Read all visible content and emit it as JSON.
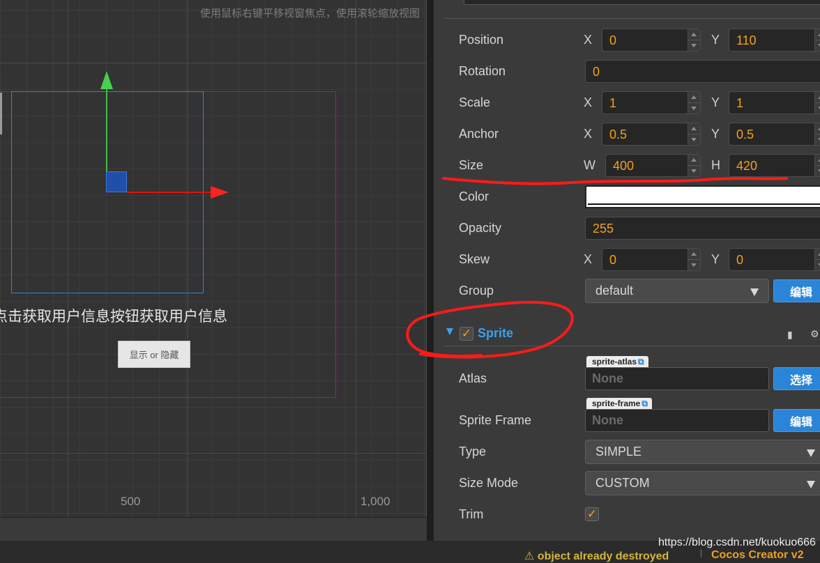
{
  "scene": {
    "hint": "使用鼠标右键平移视窗焦点，使用滚轮缩放视图",
    "label": "点击获取用户信息按钮获取用户信息",
    "button": "显示 or 隐藏",
    "ticks": [
      "500",
      "1,000"
    ]
  },
  "inspector": {
    "position": {
      "label": "Position",
      "x_axis": "X",
      "x": "0",
      "y_axis": "Y",
      "y": "110"
    },
    "rotation": {
      "label": "Rotation",
      "value": "0"
    },
    "scale": {
      "label": "Scale",
      "x_axis": "X",
      "x": "1",
      "y_axis": "Y",
      "y": "1"
    },
    "anchor": {
      "label": "Anchor",
      "x_axis": "X",
      "x": "0.5",
      "y_axis": "Y",
      "y": "0.5"
    },
    "size": {
      "label": "Size",
      "w_axis": "W",
      "w": "400",
      "h_axis": "H",
      "h": "420"
    },
    "color": {
      "label": "Color",
      "value": "#ffffff"
    },
    "opacity": {
      "label": "Opacity",
      "value": "255"
    },
    "skew": {
      "label": "Skew",
      "x_axis": "X",
      "x": "0",
      "y_axis": "Y",
      "y": "0"
    },
    "group": {
      "label": "Group",
      "value": "default",
      "edit_button": "编辑"
    },
    "sprite": {
      "title": "Sprite",
      "enabled": true,
      "atlas": {
        "label": "Atlas",
        "tag": "sprite-atlas",
        "value": "None",
        "button": "选择"
      },
      "sprite_frame": {
        "label": "Sprite Frame",
        "tag": "sprite-frame",
        "value": "None",
        "button": "编辑"
      },
      "type": {
        "label": "Type",
        "value": "SIMPLE"
      },
      "size_mode": {
        "label": "Size Mode",
        "value": "CUSTOM"
      },
      "trim": {
        "label": "Trim",
        "checked": true
      }
    }
  },
  "status": {
    "watermark": "https://blog.csdn.net/kuokuo666",
    "warning": "object already destroyed",
    "version": "Cocos Creator v2"
  },
  "colors": {
    "accent": "#2a85d8",
    "value_text": "#f6a01a",
    "annotation": "#ff1a1a"
  }
}
